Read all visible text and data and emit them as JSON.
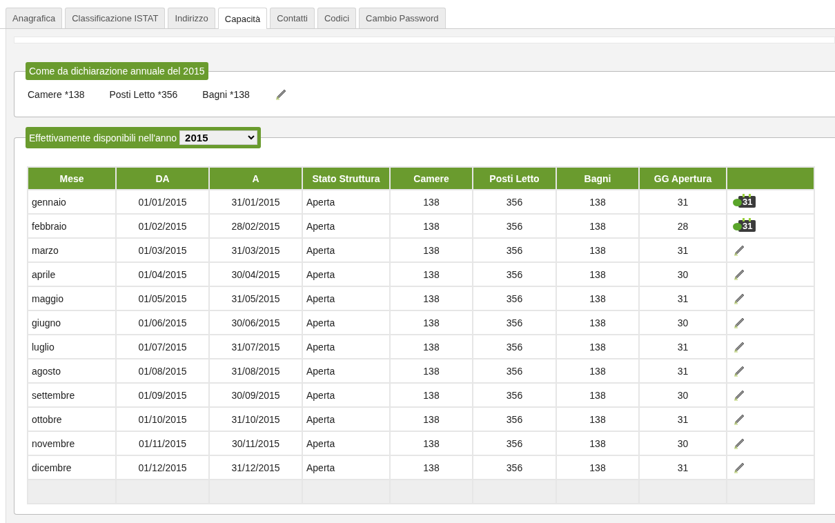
{
  "tabs": [
    {
      "label": "Anagrafica",
      "selected": false
    },
    {
      "label": "Classificazione ISTAT",
      "selected": false
    },
    {
      "label": "Indirizzo",
      "selected": false
    },
    {
      "label": "Capacità",
      "selected": true
    },
    {
      "label": "Contatti",
      "selected": false
    },
    {
      "label": "Codici",
      "selected": false
    },
    {
      "label": "Cambio Password",
      "selected": false
    }
  ],
  "declared": {
    "legend": "Come da dichiarazione annuale del 2015",
    "items": [
      "Camere *138",
      "Posti Letto *356",
      "Bagni *138"
    ]
  },
  "available": {
    "legend": "Effettivamente disponibili nell'anno",
    "year": "2015",
    "table": {
      "columns": [
        "Mese",
        "DA",
        "A",
        "Stato Struttura",
        "Camere",
        "Posti Letto",
        "Bagni",
        "GG Apertura"
      ],
      "rows": [
        {
          "cells": [
            "gennaio",
            "01/01/2015",
            "31/01/2015",
            "Aperta",
            "138",
            "356",
            "138",
            "31"
          ],
          "action": {
            "kind": "calendar",
            "label": "31"
          }
        },
        {
          "cells": [
            "febbraio",
            "01/02/2015",
            "28/02/2015",
            "Aperta",
            "138",
            "356",
            "138",
            "28"
          ],
          "action": {
            "kind": "calendar",
            "label": "31"
          }
        },
        {
          "cells": [
            "marzo",
            "01/03/2015",
            "31/03/2015",
            "Aperta",
            "138",
            "356",
            "138",
            "31"
          ],
          "action": {
            "kind": "edit"
          }
        },
        {
          "cells": [
            "aprile",
            "01/04/2015",
            "30/04/2015",
            "Aperta",
            "138",
            "356",
            "138",
            "30"
          ],
          "action": {
            "kind": "edit"
          }
        },
        {
          "cells": [
            "maggio",
            "01/05/2015",
            "31/05/2015",
            "Aperta",
            "138",
            "356",
            "138",
            "31"
          ],
          "action": {
            "kind": "edit"
          }
        },
        {
          "cells": [
            "giugno",
            "01/06/2015",
            "30/06/2015",
            "Aperta",
            "138",
            "356",
            "138",
            "30"
          ],
          "action": {
            "kind": "edit"
          }
        },
        {
          "cells": [
            "luglio",
            "01/07/2015",
            "31/07/2015",
            "Aperta",
            "138",
            "356",
            "138",
            "31"
          ],
          "action": {
            "kind": "edit"
          }
        },
        {
          "cells": [
            "agosto",
            "01/08/2015",
            "31/08/2015",
            "Aperta",
            "138",
            "356",
            "138",
            "31"
          ],
          "action": {
            "kind": "edit"
          }
        },
        {
          "cells": [
            "settembre",
            "01/09/2015",
            "30/09/2015",
            "Aperta",
            "138",
            "356",
            "138",
            "30"
          ],
          "action": {
            "kind": "edit"
          }
        },
        {
          "cells": [
            "ottobre",
            "01/10/2015",
            "31/10/2015",
            "Aperta",
            "138",
            "356",
            "138",
            "31"
          ],
          "action": {
            "kind": "edit"
          }
        },
        {
          "cells": [
            "novembre",
            "01/11/2015",
            "30/11/2015",
            "Aperta",
            "138",
            "356",
            "138",
            "30"
          ],
          "action": {
            "kind": "edit"
          }
        },
        {
          "cells": [
            "dicembre",
            "01/12/2015",
            "31/12/2015",
            "Aperta",
            "138",
            "356",
            "138",
            "31"
          ],
          "action": {
            "kind": "edit"
          }
        }
      ]
    }
  }
}
